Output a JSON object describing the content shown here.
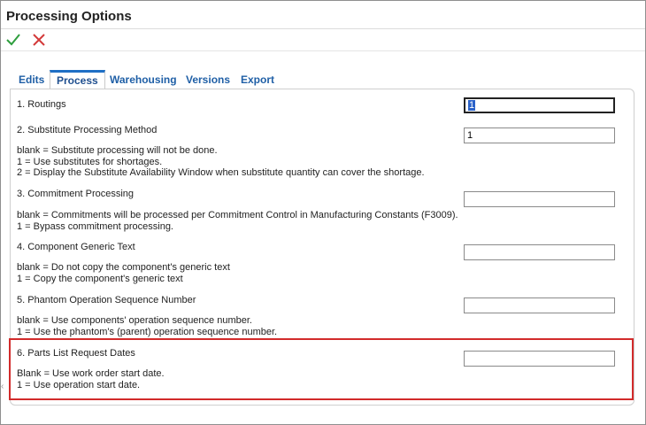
{
  "window": {
    "title": "Processing Options"
  },
  "toolbar": {
    "ok_icon": "checkmark-icon",
    "cancel_icon": "close-icon",
    "ok_color": "#2e9e3e",
    "cancel_color": "#d33a3a"
  },
  "tabs": [
    {
      "label": "Edits",
      "active": false
    },
    {
      "label": "Process",
      "active": true
    },
    {
      "label": "Warehousing",
      "active": false
    },
    {
      "label": "Versions",
      "active": false
    },
    {
      "label": "Export",
      "active": false
    }
  ],
  "options": [
    {
      "label": "1. Routings",
      "value": "1",
      "desc": []
    },
    {
      "label": "2. Substitute Processing Method",
      "value": "1",
      "desc": [
        "blank = Substitute processing will not be done.",
        "1 = Use substitutes for shortages.",
        "2 = Display the Substitute Availability Window when substitute quantity can cover the shortage."
      ]
    },
    {
      "label": "3. Commitment Processing",
      "value": "",
      "desc": [
        "blank = Commitments will be processed per Commitment Control in Manufacturing Constants (F3009).",
        "1 = Bypass commitment processing."
      ]
    },
    {
      "label": "4. Component Generic Text",
      "value": "",
      "desc": [
        "blank = Do not copy the component's generic text",
        "1 = Copy the component's generic text"
      ]
    },
    {
      "label": "5. Phantom Operation Sequence Number",
      "value": "",
      "desc": [
        "blank = Use components' operation sequence number.",
        "1 = Use the phantom's (parent) operation sequence number."
      ]
    },
    {
      "label": "6. Parts List Request Dates",
      "value": "",
      "desc": [
        "Blank = Use work order start date.",
        "1 = Use operation start date."
      ]
    }
  ],
  "highlight_color": "#d22b2b"
}
